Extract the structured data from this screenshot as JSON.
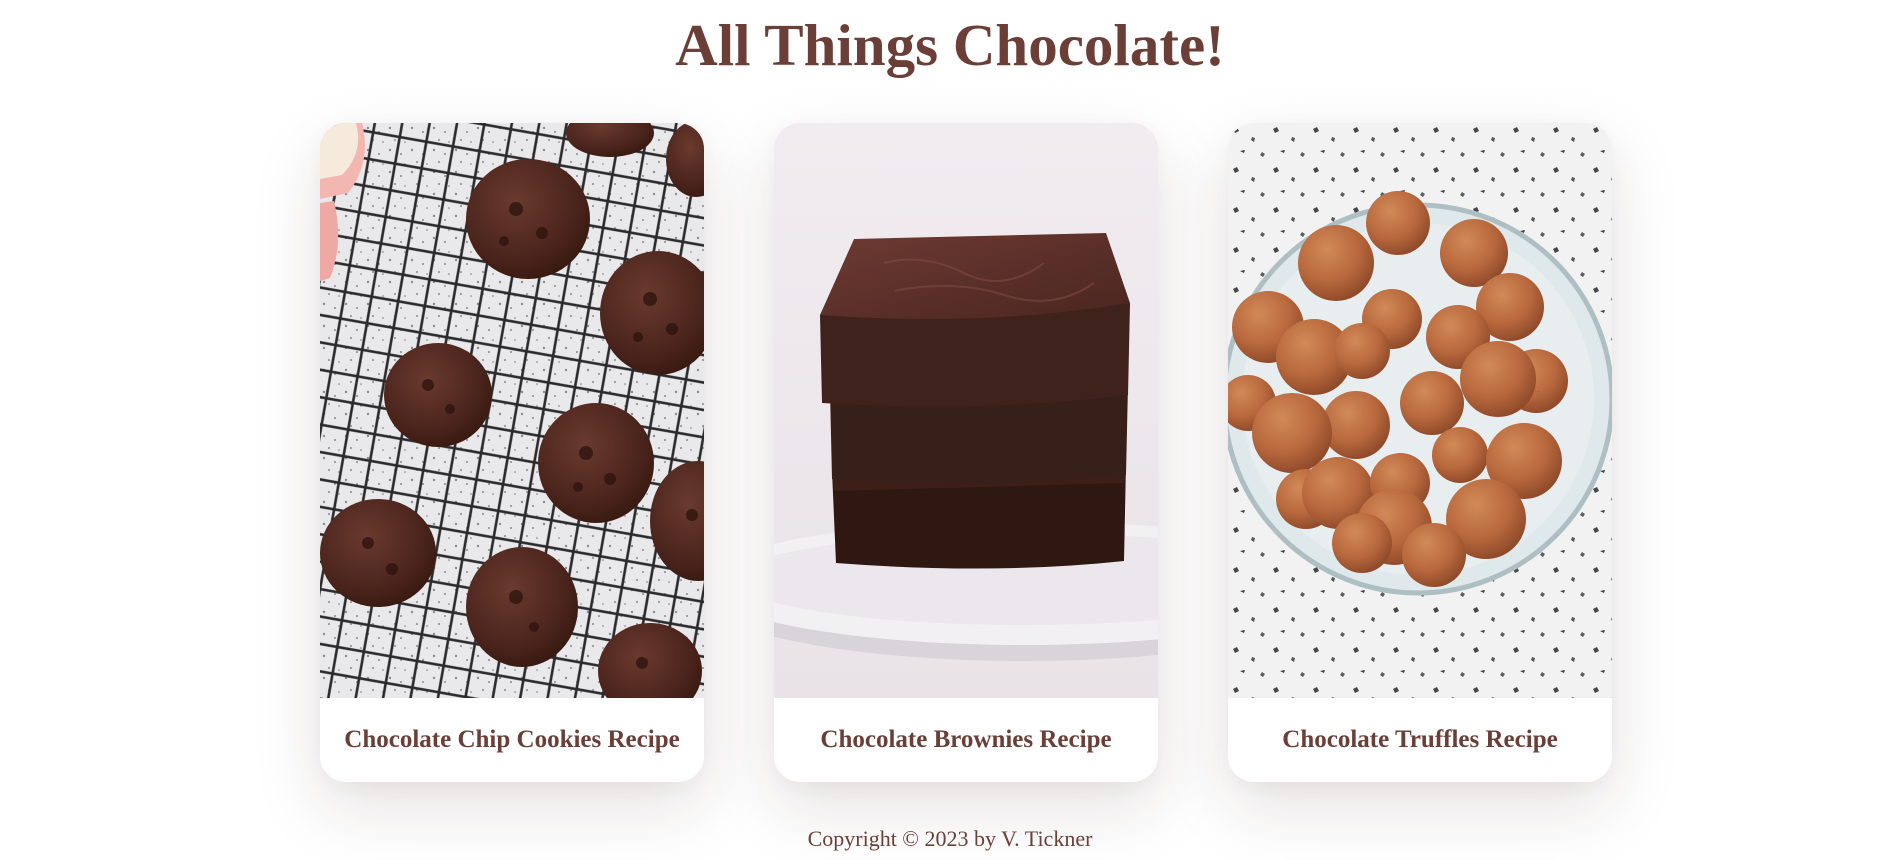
{
  "page": {
    "title": "All Things Chocolate!",
    "footer": "Copyright © 2023 by V. Tickner"
  },
  "cards": [
    {
      "caption": "Chocolate Chip Cookies Recipe",
      "image_subject": "chocolate chip cookies on a cooling rack"
    },
    {
      "caption": "Chocolate Brownies Recipe",
      "image_subject": "stacked chocolate brownies on a white plate"
    },
    {
      "caption": "Chocolate Truffles Recipe",
      "image_subject": "cocoa-dusted chocolate truffles on a glass plate"
    }
  ],
  "colors": {
    "text": "#6b3f37",
    "background": "#ffffff",
    "chocolate": "#4a2a24",
    "cocoa": "#b8683d"
  }
}
